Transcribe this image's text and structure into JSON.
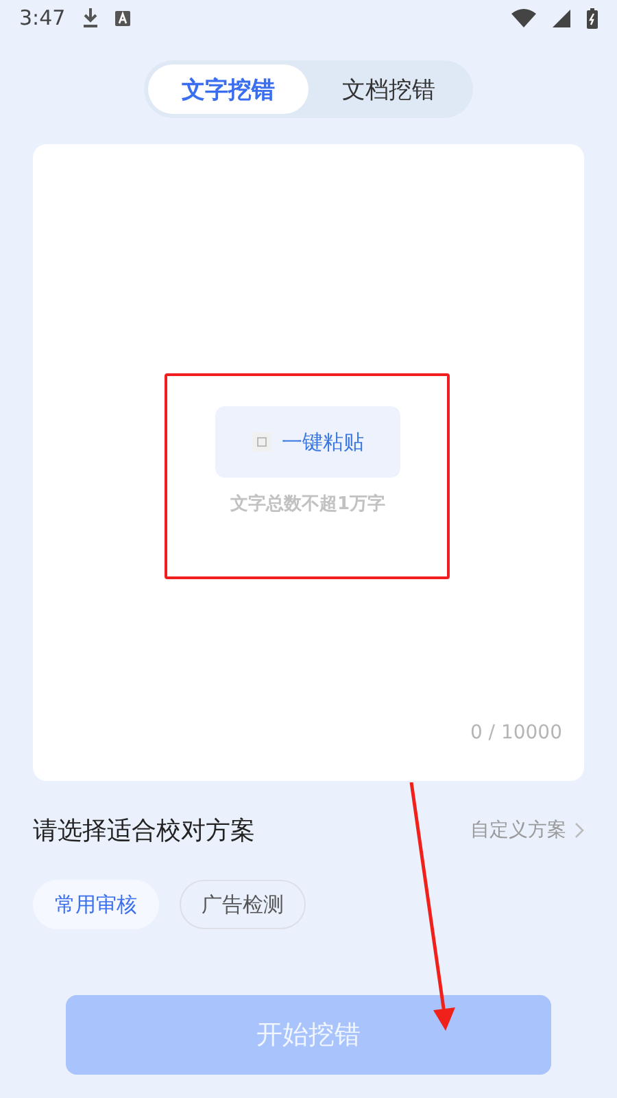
{
  "status_bar": {
    "time": "3:47"
  },
  "tabs": [
    {
      "label": "文字挖错",
      "selected": true
    },
    {
      "label": "文档挖错",
      "selected": false
    }
  ],
  "editor": {
    "paste_button": "一键粘贴",
    "hint": "文字总数不超1万字",
    "counter": "0 / 10000"
  },
  "plans": {
    "heading": "请选择适合校对方案",
    "custom_link": "自定义方案",
    "chips": [
      {
        "label": "常用审核",
        "selected": true
      },
      {
        "label": "广告检测",
        "selected": false
      }
    ]
  },
  "start_button": {
    "label": "开始挖错",
    "disabled": true
  }
}
